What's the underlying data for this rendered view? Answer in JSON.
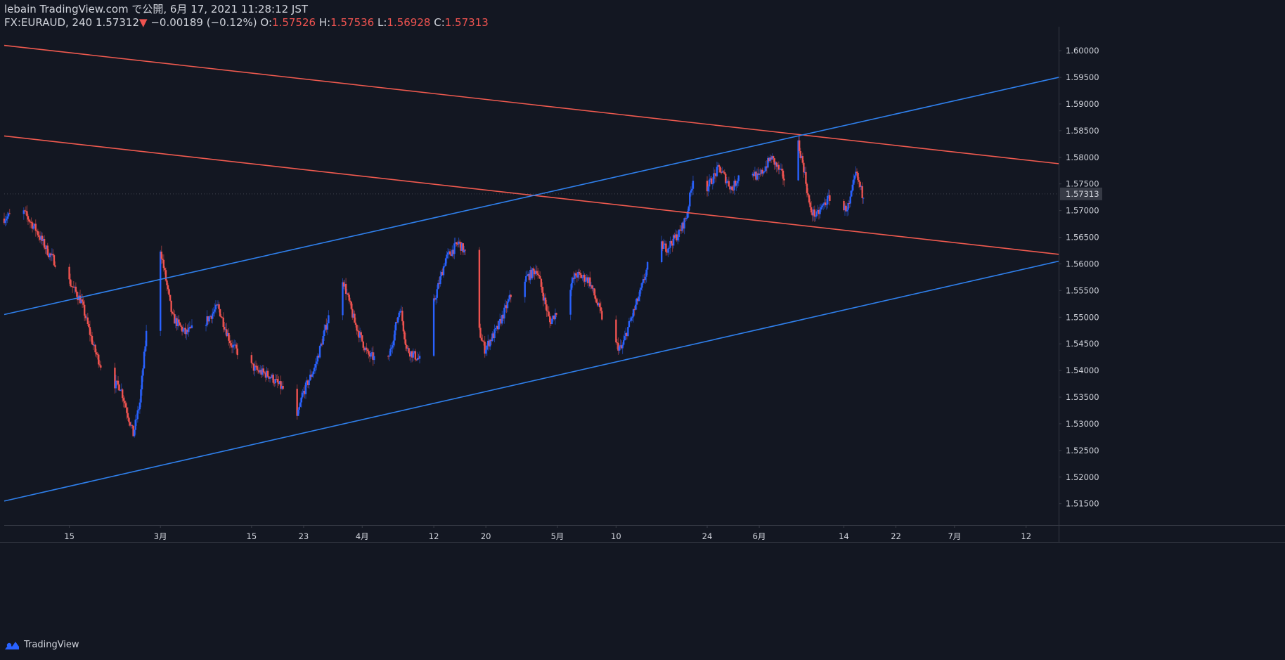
{
  "header": {
    "line1": "lebain TradingView.com で公開, 6月 17, 2021 11:28:12 JST",
    "symbol": "FX:EURAUD, 240",
    "last": "1.57312",
    "arrow": "▼",
    "change": "−0.00189 (−0.12%)",
    "o_label": "O:",
    "o_value": "1.57526",
    "h_label": "H:",
    "h_value": "1.57536",
    "l_label": "L:",
    "l_value": "1.56928",
    "c_label": "C:",
    "c_value": "1.57313"
  },
  "footer": {
    "brand": "TradingView",
    "logo_icon": "tradingview-logo-icon"
  },
  "colors": {
    "background": "#131722",
    "up": "#2962ff",
    "down": "#ef5350",
    "channel_blue": "#2f80ed",
    "channel_red": "#f05a4f",
    "axis_line": "#363a45",
    "text": "#d1d4dc"
  },
  "chart_data": {
    "type": "candlestick",
    "symbol": "FX:EURAUD",
    "interval": "240",
    "ylim": [
      1.511,
      1.6045
    ],
    "y_ticks": [
      "1.60000",
      "1.59500",
      "1.59000",
      "1.58500",
      "1.58000",
      "1.57500",
      "1.57000",
      "1.56500",
      "1.56000",
      "1.55500",
      "1.55000",
      "1.54500",
      "1.54000",
      "1.53500",
      "1.53000",
      "1.52500",
      "1.52000",
      "1.51500"
    ],
    "x_ticks": [
      "15",
      "3月",
      "15",
      "23",
      "4月",
      "12",
      "20",
      "5月",
      "10",
      "24",
      "6月",
      "14",
      "22",
      "7月",
      "12"
    ],
    "last_price_label": "1.57313",
    "trend_lines": [
      {
        "name": "upper-red-line",
        "color": "red",
        "from": {
          "x": "2021-02-05",
          "y": 1.601
        },
        "to": {
          "x": "2021-07-17",
          "y": 1.5788
        }
      },
      {
        "name": "lower-red-line",
        "color": "red",
        "from": {
          "x": "2021-02-05",
          "y": 1.584
        },
        "to": {
          "x": "2021-07-17",
          "y": 1.5618
        }
      },
      {
        "name": "upper-blue-line",
        "color": "blue",
        "from": {
          "x": "2021-02-05",
          "y": 1.5505
        },
        "to": {
          "x": "2021-07-17",
          "y": 1.595
        }
      },
      {
        "name": "lower-blue-line",
        "color": "blue",
        "from": {
          "x": "2021-02-05",
          "y": 1.5155
        },
        "to": {
          "x": "2021-07-17",
          "y": 1.5605
        }
      }
    ],
    "price_path": [
      {
        "x": "2021-02-05",
        "y": 1.5685
      },
      {
        "x": "2021-02-08",
        "y": 1.57
      },
      {
        "x": "2021-02-10",
        "y": 1.5665
      },
      {
        "x": "2021-02-12",
        "y": 1.562
      },
      {
        "x": "2021-02-15",
        "y": 1.557
      },
      {
        "x": "2021-02-17",
        "y": 1.553
      },
      {
        "x": "2021-02-19",
        "y": 1.544
      },
      {
        "x": "2021-02-21",
        "y": 1.538
      },
      {
        "x": "2021-02-23",
        "y": 1.537
      },
      {
        "x": "2021-02-25",
        "y": 1.528
      },
      {
        "x": "2021-02-26",
        "y": 1.534
      },
      {
        "x": "2021-02-28",
        "y": 1.56
      },
      {
        "x": "2021-03-01",
        "y": 1.564
      },
      {
        "x": "2021-03-03",
        "y": 1.55
      },
      {
        "x": "2021-03-05",
        "y": 1.547
      },
      {
        "x": "2021-03-08",
        "y": 1.549
      },
      {
        "x": "2021-03-10",
        "y": 1.552
      },
      {
        "x": "2021-03-12",
        "y": 1.545
      },
      {
        "x": "2021-03-14",
        "y": 1.542
      },
      {
        "x": "2021-03-16",
        "y": 1.54
      },
      {
        "x": "2021-03-18",
        "y": 1.539
      },
      {
        "x": "2021-03-20",
        "y": 1.5365
      },
      {
        "x": "2021-03-22",
        "y": 1.53
      },
      {
        "x": "2021-03-23",
        "y": 1.5355
      },
      {
        "x": "2021-03-25",
        "y": 1.541
      },
      {
        "x": "2021-03-27",
        "y": 1.55
      },
      {
        "x": "2021-03-29",
        "y": 1.558
      },
      {
        "x": "2021-03-31",
        "y": 1.549
      },
      {
        "x": "2021-04-02",
        "y": 1.543
      },
      {
        "x": "2021-04-05",
        "y": 1.541
      },
      {
        "x": "2021-04-07",
        "y": 1.552
      },
      {
        "x": "2021-04-08",
        "y": 1.544
      },
      {
        "x": "2021-04-10",
        "y": 1.542
      },
      {
        "x": "2021-04-12",
        "y": 1.552
      },
      {
        "x": "2021-04-14",
        "y": 1.561
      },
      {
        "x": "2021-04-16",
        "y": 1.564
      },
      {
        "x": "2021-04-17",
        "y": 1.562
      },
      {
        "x": "2021-04-19",
        "y": 1.548
      },
      {
        "x": "2021-04-20",
        "y": 1.544
      },
      {
        "x": "2021-04-22",
        "y": 1.548
      },
      {
        "x": "2021-04-24",
        "y": 1.554
      },
      {
        "x": "2021-04-26",
        "y": 1.557
      },
      {
        "x": "2021-04-28",
        "y": 1.559
      },
      {
        "x": "2021-04-30",
        "y": 1.549
      },
      {
        "x": "2021-05-02",
        "y": 1.553
      },
      {
        "x": "2021-05-04",
        "y": 1.558
      },
      {
        "x": "2021-05-06",
        "y": 1.557
      },
      {
        "x": "2021-05-08",
        "y": 1.55
      },
      {
        "x": "2021-05-10",
        "y": 1.545
      },
      {
        "x": "2021-05-11",
        "y": 1.544
      },
      {
        "x": "2021-05-12",
        "y": 1.548
      },
      {
        "x": "2021-05-14",
        "y": 1.555
      },
      {
        "x": "2021-05-16",
        "y": 1.564
      },
      {
        "x": "2021-05-18",
        "y": 1.563
      },
      {
        "x": "2021-05-20",
        "y": 1.566
      },
      {
        "x": "2021-05-21",
        "y": 1.569
      },
      {
        "x": "2021-05-22",
        "y": 1.576
      },
      {
        "x": "2021-05-24",
        "y": 1.574
      },
      {
        "x": "2021-05-26",
        "y": 1.578
      },
      {
        "x": "2021-05-28",
        "y": 1.574
      },
      {
        "x": "2021-05-30",
        "y": 1.579
      },
      {
        "x": "2021-06-01",
        "y": 1.576
      },
      {
        "x": "2021-06-03",
        "y": 1.58
      },
      {
        "x": "2021-06-05",
        "y": 1.576
      },
      {
        "x": "2021-06-07",
        "y": 1.5835
      },
      {
        "x": "2021-06-08",
        "y": 1.578
      },
      {
        "x": "2021-06-09",
        "y": 1.57
      },
      {
        "x": "2021-06-10",
        "y": 1.569
      },
      {
        "x": "2021-06-11",
        "y": 1.571
      },
      {
        "x": "2021-06-13",
        "y": 1.574
      },
      {
        "x": "2021-06-14",
        "y": 1.57
      },
      {
        "x": "2021-06-15",
        "y": 1.571
      },
      {
        "x": "2021-06-16",
        "y": 1.577
      },
      {
        "x": "2021-06-17",
        "y": 1.5731
      }
    ]
  }
}
